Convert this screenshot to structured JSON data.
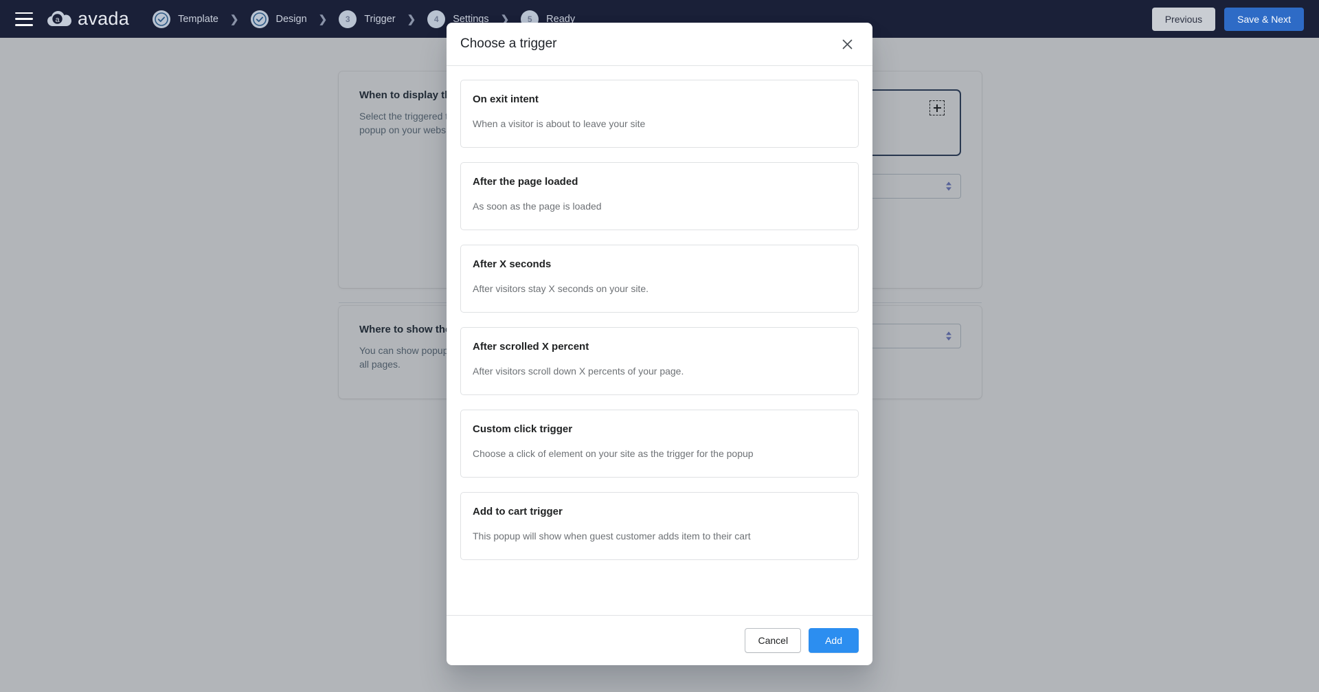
{
  "topbar": {
    "menu_icon": "hamburger-icon",
    "brand": "avada",
    "steps": [
      {
        "badge": "check",
        "label": "Template",
        "state": "done"
      },
      {
        "badge": "check",
        "label": "Design",
        "state": "done"
      },
      {
        "badge": "3",
        "label": "Trigger",
        "state": "todo"
      },
      {
        "badge": "4",
        "label": "Settings",
        "state": "todo"
      },
      {
        "badge": "5",
        "label": "Ready",
        "state": "todo"
      }
    ],
    "separator": "❯",
    "previous_label": "Previous",
    "save_next_label": "Save & Next",
    "colors": {
      "bar_bg": "#1a2038",
      "save_next_bg": "#2e6bc6",
      "previous_bg": "#c9cdd3"
    }
  },
  "page": {
    "sections": [
      {
        "title": "When to display the popup",
        "desc": "Select the triggered time to display the popup on your website"
      },
      {
        "title": "Where to show the popup",
        "desc": "You can show popup on a specific page or all pages."
      }
    ],
    "dropzone_icon": "add-trigger-icon",
    "select_icon": "select-caret-icon"
  },
  "modal": {
    "title": "Choose a trigger",
    "close_icon": "close-icon",
    "triggers": [
      {
        "name": "On exit intent",
        "desc": "When a visitor is about to leave your site"
      },
      {
        "name": "After the page loaded",
        "desc": "As soon as the page is loaded"
      },
      {
        "name": "After X seconds",
        "desc": "After visitors stay X seconds on your site."
      },
      {
        "name": "After scrolled X percent",
        "desc": "After visitors scroll down X percents of your page."
      },
      {
        "name": "Custom click trigger",
        "desc": "Choose a click of element on your site as the trigger for the popup"
      },
      {
        "name": "Add to cart trigger",
        "desc": "This popup will show when guest customer adds item to their cart"
      }
    ],
    "cancel_label": "Cancel",
    "add_label": "Add",
    "colors": {
      "add_bg": "#2c8ef0"
    }
  }
}
